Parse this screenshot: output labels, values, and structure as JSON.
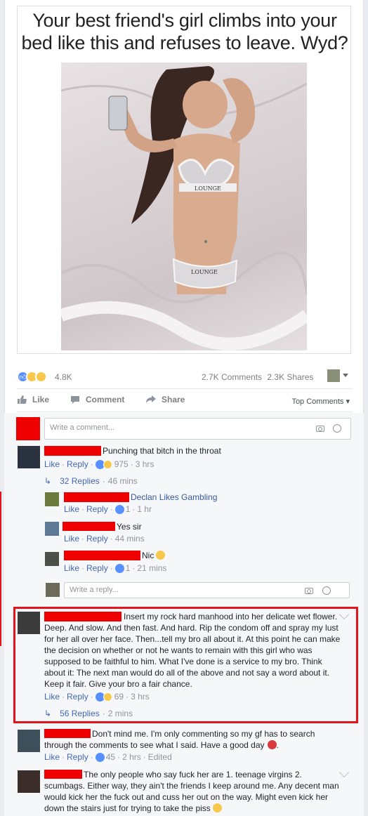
{
  "post": {
    "meme_caption": "Your best friend's girl climbs into your bed like this and refuses to leave. Wyd?",
    "photo_text": [
      "LOUNGE",
      "LOUNGE",
      "LOUNGE"
    ],
    "reaction_count": "4.8K",
    "comments_count": "2.7K Comments",
    "shares_count": "2.3K Shares"
  },
  "actions": {
    "like": "Like",
    "comment": "Comment",
    "share": "Share",
    "sort": "Top Comments"
  },
  "composer": {
    "placeholder": "Write a comment..."
  },
  "reply_composer": {
    "placeholder": "Write a reply..."
  },
  "common": {
    "like": "Like",
    "reply": "Reply",
    "edited": "Edited"
  },
  "comments": [
    {
      "text": "Punching that bitch in the throat",
      "reactions": "975",
      "time": "3 hrs",
      "replies_label": "32 Replies",
      "replies_time": "46 mins",
      "replies": [
        {
          "name": "Declan Likes Gambling",
          "reactions": "1",
          "time": "1 hr"
        },
        {
          "text": "Yes sir",
          "time": "44 mins"
        },
        {
          "text": "Nic",
          "reactions": "1",
          "time": "21 mins"
        }
      ]
    },
    {
      "text": "Insert my rock hard manhood into her delicate wet flower. Deep. And slow. And then fast. And hard. Rip the condom off and spray my lust for her all over her face. Then...tell my bro all about it. At this point he can make the decision on whether or not he wants to remain with this girl who was supposed to be faithful to him. What I've done is a service to my bro. Think about it: The next man would do all of the above and not say a word about it. Keep it fair. Give your bro a fair chance.",
      "reactions": "69",
      "time": "3 hrs",
      "replies_label": "56 Replies",
      "replies_time": "2 mins"
    },
    {
      "text": "Don't mind me. I'm only commenting so my gf has to search through the comments to see what I said. Have a good day",
      "reactions": "45",
      "time": "2 hrs"
    },
    {
      "text": "The only people who say fuck her are 1. teenage virgins 2. scumbags. Either way, they ain't the friends I keep around me. Any decent man would kick her the fuck out and cuss her out on the way. Might even kick her down the stairs just for trying to take the piss"
    }
  ]
}
